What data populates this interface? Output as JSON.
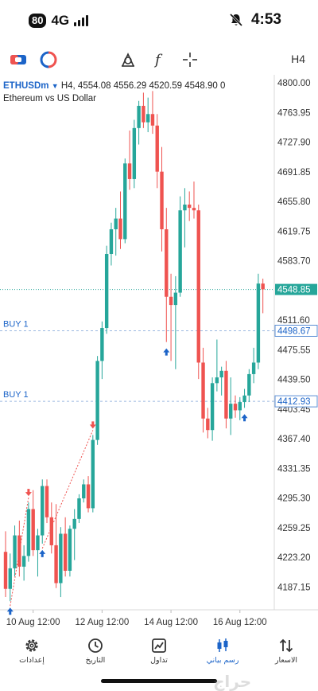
{
  "status_bar": {
    "battery": "80",
    "network": "4G",
    "time": "4:53"
  },
  "toolbar": {
    "icons": [
      "trade-icon",
      "indicator-icon",
      "objects-icon",
      "function-icon",
      "crosshair-icon"
    ],
    "timeframe": "H4"
  },
  "chart_header": {
    "symbol": "ETHUSDm",
    "summary": "H4, 4554.08 4556.29 4520.59 4548.90 0",
    "description": "Ethereum vs US Dollar"
  },
  "chart_data": {
    "type": "candlestick",
    "timeframe": "H4",
    "ylim": [
      4160,
      4810
    ],
    "price_ticks": [
      "4800.00",
      "4763.95",
      "4727.90",
      "4691.85",
      "4655.80",
      "4619.75",
      "4583.70",
      "4511.60",
      "4475.55",
      "4439.50",
      "4403.45",
      "4367.40",
      "4331.35",
      "4295.30",
      "4259.25",
      "4223.20",
      "4187.15"
    ],
    "time_labels": [
      "10 Aug 12:00",
      "12 Aug 12:00",
      "14 Aug 12:00",
      "16 Aug 12:00"
    ],
    "current_price": "4548.85",
    "up_color": "#26a69a",
    "down_color": "#ef5350",
    "candles": [
      {
        "o": 4230,
        "h": 4255,
        "l": 4175,
        "c": 4185
      },
      {
        "o": 4185,
        "h": 4228,
        "l": 4170,
        "c": 4210
      },
      {
        "o": 4210,
        "h": 4262,
        "l": 4200,
        "c": 4250
      },
      {
        "o": 4250,
        "h": 4268,
        "l": 4200,
        "c": 4212
      },
      {
        "o": 4212,
        "h": 4238,
        "l": 4195,
        "c": 4225
      },
      {
        "o": 4225,
        "h": 4290,
        "l": 4218,
        "c": 4282
      },
      {
        "o": 4282,
        "h": 4305,
        "l": 4225,
        "c": 4232
      },
      {
        "o": 4232,
        "h": 4258,
        "l": 4200,
        "c": 4250
      },
      {
        "o": 4250,
        "h": 4318,
        "l": 4240,
        "c": 4310
      },
      {
        "o": 4310,
        "h": 4318,
        "l": 4265,
        "c": 4272
      },
      {
        "o": 4272,
        "h": 4290,
        "l": 4228,
        "c": 4238
      },
      {
        "o": 4238,
        "h": 4288,
        "l": 4186,
        "c": 4192
      },
      {
        "o": 4192,
        "h": 4260,
        "l": 4175,
        "c": 4252
      },
      {
        "o": 4252,
        "h": 4272,
        "l": 4200,
        "c": 4207
      },
      {
        "o": 4207,
        "h": 4262,
        "l": 4200,
        "c": 4258
      },
      {
        "o": 4258,
        "h": 4282,
        "l": 4220,
        "c": 4270
      },
      {
        "o": 4270,
        "h": 4300,
        "l": 4265,
        "c": 4295
      },
      {
        "o": 4295,
        "h": 4318,
        "l": 4290,
        "c": 4312
      },
      {
        "o": 4312,
        "h": 4322,
        "l": 4278,
        "c": 4283
      },
      {
        "o": 4283,
        "h": 4372,
        "l": 4278,
        "c": 4366
      },
      {
        "o": 4366,
        "h": 4468,
        "l": 4360,
        "c": 4462
      },
      {
        "o": 4462,
        "h": 4510,
        "l": 4440,
        "c": 4502
      },
      {
        "o": 4502,
        "h": 4602,
        "l": 4495,
        "c": 4592
      },
      {
        "o": 4592,
        "h": 4630,
        "l": 4578,
        "c": 4622
      },
      {
        "o": 4622,
        "h": 4648,
        "l": 4590,
        "c": 4635
      },
      {
        "o": 4635,
        "h": 4668,
        "l": 4598,
        "c": 4610
      },
      {
        "o": 4610,
        "h": 4708,
        "l": 4605,
        "c": 4702
      },
      {
        "o": 4702,
        "h": 4742,
        "l": 4670,
        "c": 4683
      },
      {
        "o": 4683,
        "h": 4755,
        "l": 4672,
        "c": 4745
      },
      {
        "o": 4745,
        "h": 4778,
        "l": 4725,
        "c": 4772
      },
      {
        "o": 4772,
        "h": 4788,
        "l": 4745,
        "c": 4752
      },
      {
        "o": 4752,
        "h": 4782,
        "l": 4740,
        "c": 4762
      },
      {
        "o": 4762,
        "h": 4790,
        "l": 4738,
        "c": 4748
      },
      {
        "o": 4748,
        "h": 4762,
        "l": 4672,
        "c": 4692
      },
      {
        "o": 4692,
        "h": 4722,
        "l": 4595,
        "c": 4622
      },
      {
        "o": 4622,
        "h": 4648,
        "l": 4485,
        "c": 4540
      },
      {
        "o": 4540,
        "h": 4568,
        "l": 4462,
        "c": 4530
      },
      {
        "o": 4530,
        "h": 4565,
        "l": 4452,
        "c": 4545
      },
      {
        "o": 4545,
        "h": 4662,
        "l": 4540,
        "c": 4645
      },
      {
        "o": 4645,
        "h": 4672,
        "l": 4600,
        "c": 4652
      },
      {
        "o": 4652,
        "h": 4668,
        "l": 4632,
        "c": 4648
      },
      {
        "o": 4648,
        "h": 4680,
        "l": 4635,
        "c": 4645
      },
      {
        "o": 4645,
        "h": 4652,
        "l": 4440,
        "c": 4460
      },
      {
        "o": 4460,
        "h": 4478,
        "l": 4375,
        "c": 4392
      },
      {
        "o": 4392,
        "h": 4405,
        "l": 4368,
        "c": 4378
      },
      {
        "o": 4378,
        "h": 4442,
        "l": 4365,
        "c": 4435
      },
      {
        "o": 4435,
        "h": 4488,
        "l": 4425,
        "c": 4442
      },
      {
        "o": 4442,
        "h": 4455,
        "l": 4420,
        "c": 4450
      },
      {
        "o": 4450,
        "h": 4462,
        "l": 4380,
        "c": 4392
      },
      {
        "o": 4392,
        "h": 4442,
        "l": 4372,
        "c": 4410
      },
      {
        "o": 4410,
        "h": 4420,
        "l": 4393,
        "c": 4402
      },
      {
        "o": 4402,
        "h": 4418,
        "l": 4390,
        "c": 4412
      },
      {
        "o": 4412,
        "h": 4428,
        "l": 4405,
        "c": 4420
      },
      {
        "o": 4420,
        "h": 4452,
        "l": 4412,
        "c": 4446
      },
      {
        "o": 4446,
        "h": 4478,
        "l": 4435,
        "c": 4460
      },
      {
        "o": 4460,
        "h": 4568,
        "l": 4452,
        "c": 4556
      },
      {
        "o": 4556,
        "h": 4562,
        "l": 4520,
        "c": 4549
      }
    ],
    "orders": [
      {
        "label": "BUY 1",
        "price": 4498.67
      },
      {
        "label": "BUY 1",
        "price": 4412.93
      }
    ],
    "arrows": [
      {
        "i": 1,
        "dir": "up"
      },
      {
        "i": 5,
        "dir": "down"
      },
      {
        "i": 8,
        "dir": "up"
      },
      {
        "i": 19,
        "dir": "down"
      },
      {
        "i": 35,
        "dir": "up"
      },
      {
        "i": 52,
        "dir": "up"
      }
    ]
  },
  "tabs": [
    {
      "label": "إعدادات",
      "icon": "gear-icon",
      "active": false
    },
    {
      "label": "التاريخ",
      "icon": "history-icon",
      "active": false
    },
    {
      "label": "تداول",
      "icon": "trade-chart-icon",
      "active": false
    },
    {
      "label": "رسم بياني",
      "icon": "candles-icon",
      "active": true
    },
    {
      "label": "الاسعار",
      "icon": "quotes-icon",
      "active": false
    }
  ],
  "watermark": "حراج"
}
